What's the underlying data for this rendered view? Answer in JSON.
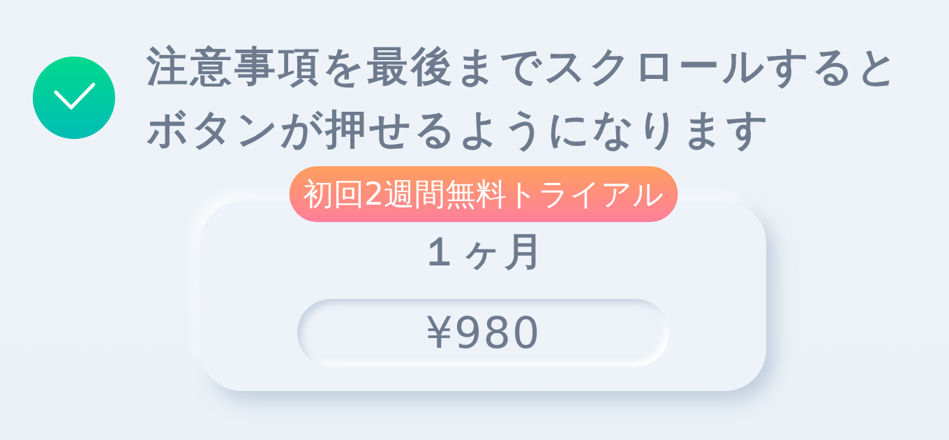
{
  "notice": {
    "text": "注意事項を最後までスクロールするとボタンが押せるようになります"
  },
  "plan": {
    "badge": "初回2週間無料トライアル",
    "name": "１ヶ月",
    "price": "¥980"
  }
}
